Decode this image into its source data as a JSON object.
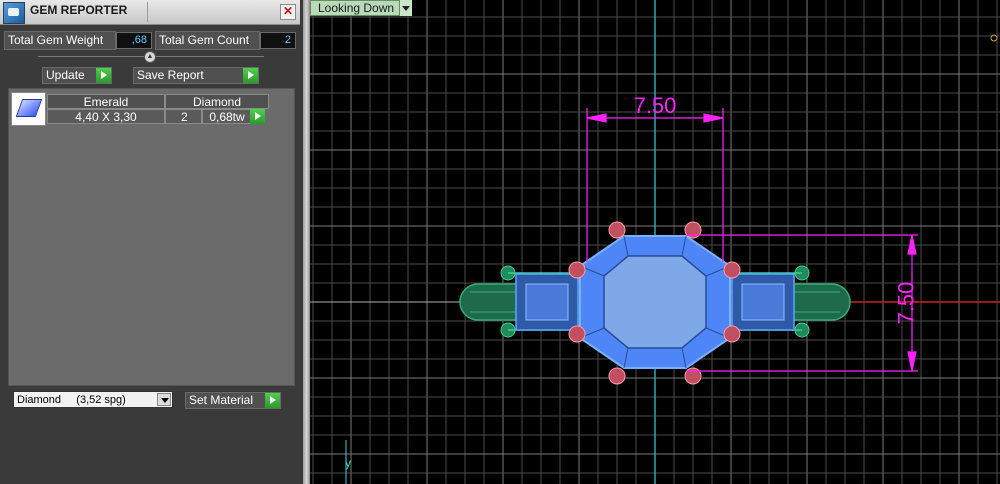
{
  "panel": {
    "title": "GEM REPORTER",
    "close_glyph": "✕",
    "total_weight_label": "Total Gem Weight",
    "total_weight_value": ",68",
    "total_count_label": "Total Gem Count",
    "total_count_value": "2",
    "update_label": "Update",
    "save_report_label": "Save Report",
    "table": {
      "columns": [
        "Emerald",
        "Diamond"
      ],
      "row": {
        "size": "4,40 X 3,30",
        "count": "2",
        "weight": "0,68tw"
      }
    },
    "material_select": "Diamond     (3,52 spg)",
    "set_material_label": "Set Material"
  },
  "viewport": {
    "view_name": "Looking Down",
    "dimension_top": "7.50",
    "dimension_side": "7.50",
    "axis_label": "y"
  },
  "colors": {
    "accent_green": "#35b535",
    "dimension_magenta": "#ff22ff",
    "gem_blue": "#4f86f7",
    "band_green": "#1f8a5a"
  }
}
